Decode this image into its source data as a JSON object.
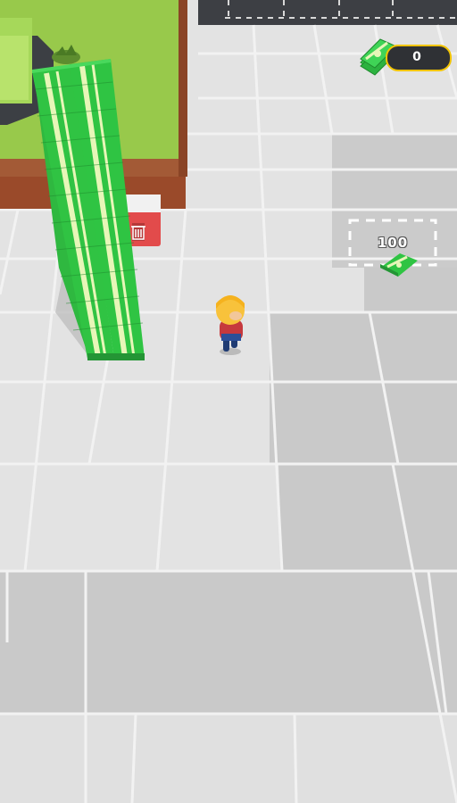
{
  "hud": {
    "money_value": "0",
    "money_icon": "cash-stack-icon"
  },
  "unlock_pad": {
    "price_label": "100",
    "icon": "cash-bundle-icon"
  },
  "colors": {
    "floor": "#e3e3e3",
    "floor_dark": "#c9c9c9",
    "grass": "#98c94b",
    "soil": "#9a4a2a",
    "cash": "#37c94a",
    "trash": "#e24b4b",
    "hud_border": "#f2c400"
  }
}
